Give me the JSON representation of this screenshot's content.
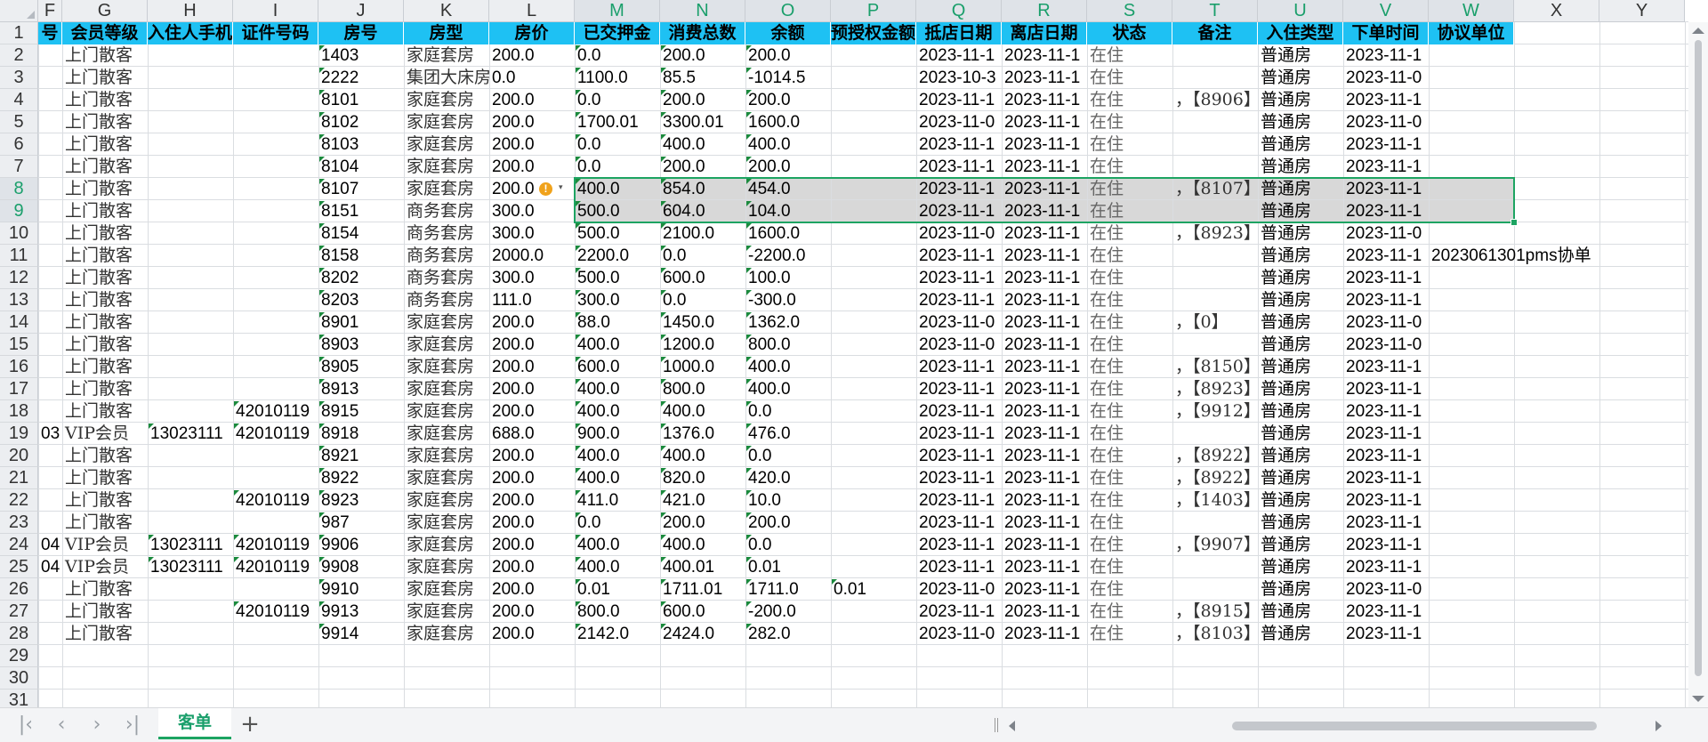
{
  "columns": [
    {
      "letter": "F"
    },
    {
      "letter": "G"
    },
    {
      "letter": "H"
    },
    {
      "letter": "I"
    },
    {
      "letter": "J"
    },
    {
      "letter": "K"
    },
    {
      "letter": "L"
    },
    {
      "letter": "M"
    },
    {
      "letter": "N"
    },
    {
      "letter": "O"
    },
    {
      "letter": "P"
    },
    {
      "letter": "Q"
    },
    {
      "letter": "R"
    },
    {
      "letter": "S"
    },
    {
      "letter": "T"
    },
    {
      "letter": "U"
    },
    {
      "letter": "V"
    },
    {
      "letter": "W"
    },
    {
      "letter": "X"
    },
    {
      "letter": "Y"
    }
  ],
  "row_numbers": [
    "1",
    "2",
    "3",
    "4",
    "5",
    "6",
    "7",
    "8",
    "9",
    "10",
    "11",
    "12",
    "13",
    "14",
    "15",
    "16",
    "17",
    "18",
    "19",
    "20",
    "21",
    "22",
    "23",
    "24",
    "25",
    "26",
    "27",
    "28",
    "29",
    "30",
    "31"
  ],
  "headers": [
    "号",
    "会员等级",
    "入住人手机",
    "证件号码",
    "房号",
    "房型",
    "房价",
    "已交押金",
    "消费总数",
    "余额",
    "预授权金额",
    "抵店日期",
    "离店日期",
    "状态",
    "备注",
    "入住类型",
    "下单时间",
    "协议单位"
  ],
  "rows": [
    [
      "",
      "上门散客",
      "",
      "",
      "1403",
      "家庭套房",
      "200.0",
      "0.0",
      "200.0",
      "200.0",
      "",
      "2023-11-1",
      "2023-11-1",
      "在住",
      "",
      "普通房",
      "2023-11-1",
      ""
    ],
    [
      "",
      "上门散客",
      "",
      "",
      "2222",
      "集团大床房",
      "0.0",
      "1100.0",
      "85.5",
      "-1014.5",
      "",
      "2023-10-3",
      "2023-11-1",
      "在住",
      "",
      "普通房",
      "2023-11-0",
      ""
    ],
    [
      "",
      "上门散客",
      "",
      "",
      "8101",
      "家庭套房",
      "200.0",
      "0.0",
      "200.0",
      "200.0",
      "",
      "2023-11-1",
      "2023-11-1",
      "在住",
      "，【8906】",
      "普通房",
      "2023-11-1",
      ""
    ],
    [
      "",
      "上门散客",
      "",
      "",
      "8102",
      "家庭套房",
      "200.0",
      "1700.01",
      "3300.01",
      "1600.0",
      "",
      "2023-11-0",
      "2023-11-1",
      "在住",
      "",
      "普通房",
      "2023-11-0",
      ""
    ],
    [
      "",
      "上门散客",
      "",
      "",
      "8103",
      "家庭套房",
      "200.0",
      "0.0",
      "400.0",
      "400.0",
      "",
      "2023-11-1",
      "2023-11-1",
      "在住",
      "",
      "普通房",
      "2023-11-1",
      ""
    ],
    [
      "",
      "上门散客",
      "",
      "",
      "8104",
      "家庭套房",
      "200.0",
      "0.0",
      "200.0",
      "200.0",
      "",
      "2023-11-1",
      "2023-11-1",
      "在住",
      "",
      "普通房",
      "2023-11-1",
      ""
    ],
    [
      "",
      "上门散客",
      "",
      "",
      "8107",
      "家庭套房",
      "200.0",
      "400.0",
      "854.0",
      "454.0",
      "",
      "2023-11-1",
      "2023-11-1",
      "在住",
      "，【8107】",
      "普通房",
      "2023-11-1",
      ""
    ],
    [
      "",
      "上门散客",
      "",
      "",
      "8151",
      "商务套房",
      "300.0",
      "500.0",
      "604.0",
      "104.0",
      "",
      "2023-11-1",
      "2023-11-1",
      "在住",
      "",
      "普通房",
      "2023-11-1",
      ""
    ],
    [
      "",
      "上门散客",
      "",
      "",
      "8154",
      "商务套房",
      "300.0",
      "500.0",
      "2100.0",
      "1600.0",
      "",
      "2023-11-0",
      "2023-11-1",
      "在住",
      "，【8923】",
      "普通房",
      "2023-11-0",
      ""
    ],
    [
      "",
      "上门散客",
      "",
      "",
      "8158",
      "商务套房",
      "2000.0",
      "2200.0",
      "0.0",
      "-2200.0",
      "",
      "2023-11-1",
      "2023-11-1",
      "在住",
      "",
      "普通房",
      "2023-11-1",
      "2023061301pms协单"
    ],
    [
      "",
      "上门散客",
      "",
      "",
      "8202",
      "商务套房",
      "300.0",
      "500.0",
      "600.0",
      "100.0",
      "",
      "2023-11-1",
      "2023-11-1",
      "在住",
      "",
      "普通房",
      "2023-11-1",
      ""
    ],
    [
      "",
      "上门散客",
      "",
      "",
      "8203",
      "商务套房",
      "111.0",
      "300.0",
      "0.0",
      "-300.0",
      "",
      "2023-11-1",
      "2023-11-1",
      "在住",
      "",
      "普通房",
      "2023-11-1",
      ""
    ],
    [
      "",
      "上门散客",
      "",
      "",
      "8901",
      "家庭套房",
      "200.0",
      "88.0",
      "1450.0",
      "1362.0",
      "",
      "2023-11-0",
      "2023-11-1",
      "在住",
      "，【0】",
      "普通房",
      "2023-11-0",
      ""
    ],
    [
      "",
      "上门散客",
      "",
      "",
      "8903",
      "家庭套房",
      "200.0",
      "400.0",
      "1200.0",
      "800.0",
      "",
      "2023-11-0",
      "2023-11-1",
      "在住",
      "",
      "普通房",
      "2023-11-0",
      ""
    ],
    [
      "",
      "上门散客",
      "",
      "",
      "8905",
      "家庭套房",
      "200.0",
      "600.0",
      "1000.0",
      "400.0",
      "",
      "2023-11-1",
      "2023-11-1",
      "在住",
      "，【8150】",
      "普通房",
      "2023-11-1",
      ""
    ],
    [
      "",
      "上门散客",
      "",
      "",
      "8913",
      "家庭套房",
      "200.0",
      "400.0",
      "800.0",
      "400.0",
      "",
      "2023-11-1",
      "2023-11-1",
      "在住",
      "，【8923】",
      "普通房",
      "2023-11-1",
      ""
    ],
    [
      "",
      "上门散客",
      "",
      "42010119",
      "8915",
      "家庭套房",
      "200.0",
      "400.0",
      "400.0",
      "0.0",
      "",
      "2023-11-1",
      "2023-11-1",
      "在住",
      "，【9912】",
      "普通房",
      "2023-11-1",
      ""
    ],
    [
      "03",
      "VIP会员",
      "13023111",
      "42010119",
      "8918",
      "家庭套房",
      "688.0",
      "900.0",
      "1376.0",
      "476.0",
      "",
      "2023-11-1",
      "2023-11-1",
      "在住",
      "",
      "普通房",
      "2023-11-1",
      ""
    ],
    [
      "",
      "上门散客",
      "",
      "",
      "8921",
      "家庭套房",
      "200.0",
      "400.0",
      "400.0",
      "0.0",
      "",
      "2023-11-1",
      "2023-11-1",
      "在住",
      "，【8922】",
      "普通房",
      "2023-11-1",
      ""
    ],
    [
      "",
      "上门散客",
      "",
      "",
      "8922",
      "家庭套房",
      "200.0",
      "400.0",
      "820.0",
      "420.0",
      "",
      "2023-11-1",
      "2023-11-1",
      "在住",
      "，【8922】",
      "普通房",
      "2023-11-1",
      ""
    ],
    [
      "",
      "上门散客",
      "",
      "42010119",
      "8923",
      "家庭套房",
      "200.0",
      "411.0",
      "421.0",
      "10.0",
      "",
      "2023-11-1",
      "2023-11-1",
      "在住",
      "，【1403】",
      "普通房",
      "2023-11-1",
      ""
    ],
    [
      "",
      "上门散客",
      "",
      "",
      "987",
      "家庭套房",
      "200.0",
      "0.0",
      "200.0",
      "200.0",
      "",
      "2023-11-1",
      "2023-11-1",
      "在住",
      "",
      "普通房",
      "2023-11-1",
      ""
    ],
    [
      "04",
      "VIP会员",
      "13023111",
      "42010119",
      "9906",
      "家庭套房",
      "200.0",
      "400.0",
      "400.0",
      "0.0",
      "",
      "2023-11-1",
      "2023-11-1",
      "在住",
      "，【9907】",
      "普通房",
      "2023-11-1",
      ""
    ],
    [
      "04",
      "VIP会员",
      "13023111",
      "42010119",
      "9908",
      "家庭套房",
      "200.0",
      "400.0",
      "400.01",
      "0.01",
      "",
      "2023-11-1",
      "2023-11-1",
      "在住",
      "",
      "普通房",
      "2023-11-1",
      ""
    ],
    [
      "",
      "上门散客",
      "",
      "",
      "9910",
      "家庭套房",
      "200.0",
      "0.01",
      "1711.01",
      "1711.0",
      "0.01",
      "2023-11-0",
      "2023-11-1",
      "在住",
      "",
      "普通房",
      "2023-11-0",
      ""
    ],
    [
      "",
      "上门散客",
      "",
      "42010119",
      "9913",
      "家庭套房",
      "200.0",
      "800.0",
      "600.0",
      "-200.0",
      "",
      "2023-11-1",
      "2023-11-1",
      "在住",
      "，【8915】",
      "普通房",
      "2023-11-1",
      ""
    ],
    [
      "",
      "上门散客",
      "",
      "",
      "9914",
      "家庭套房",
      "200.0",
      "2142.0",
      "2424.0",
      "282.0",
      "",
      "2023-11-0",
      "2023-11-1",
      "在住",
      "，【8103】",
      "普通房",
      "2023-11-1",
      ""
    ]
  ],
  "selection": {
    "columns": [
      "M",
      "N",
      "O",
      "P",
      "Q",
      "R",
      "S",
      "T",
      "U",
      "V",
      "W"
    ],
    "rows": [
      "8",
      "9"
    ]
  },
  "warning": {
    "icon": "warning-icon",
    "cell": "L8",
    "arrow": "▾"
  },
  "tabs": [
    {
      "label": "客单",
      "active": true
    }
  ],
  "nav": {
    "first": "|‹",
    "prev": "‹",
    "next": "›",
    "last": "›|",
    "add": "+"
  },
  "colors": {
    "header_bg": "#1ec1f3",
    "selection_border": "#1da462",
    "selected_heading": "#1a9f6b",
    "warning": "#f0a21b"
  }
}
